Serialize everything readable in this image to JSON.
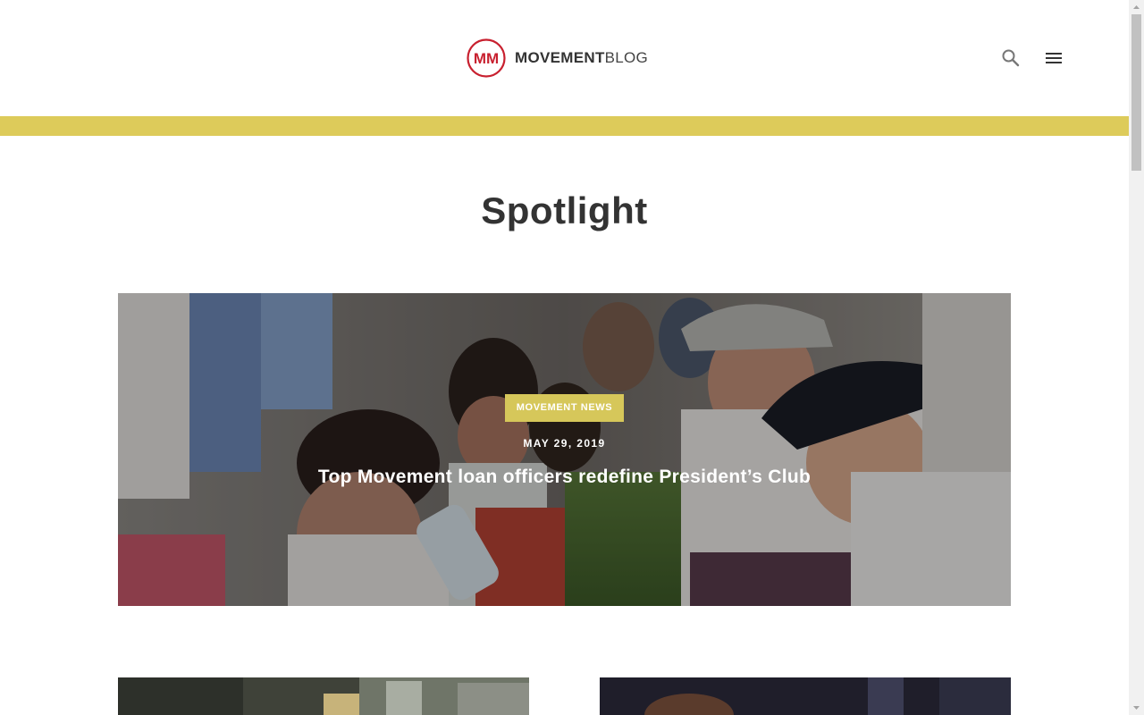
{
  "header": {
    "brand_bold": "MOVEMENT",
    "brand_light": "BLOG",
    "logo_initials": "MM",
    "search_icon": "search-icon",
    "menu_icon": "hamburger-menu-icon"
  },
  "page": {
    "title": "Spotlight"
  },
  "hero": {
    "category": "MOVEMENT NEWS",
    "date": "MAY 29, 2019",
    "title": "Top Movement loan officers redefine President’s Club"
  },
  "colors": {
    "accent": "#ddcb5a",
    "badge": "#d6c75a",
    "brand_red": "#c8202f",
    "text": "#333333"
  }
}
